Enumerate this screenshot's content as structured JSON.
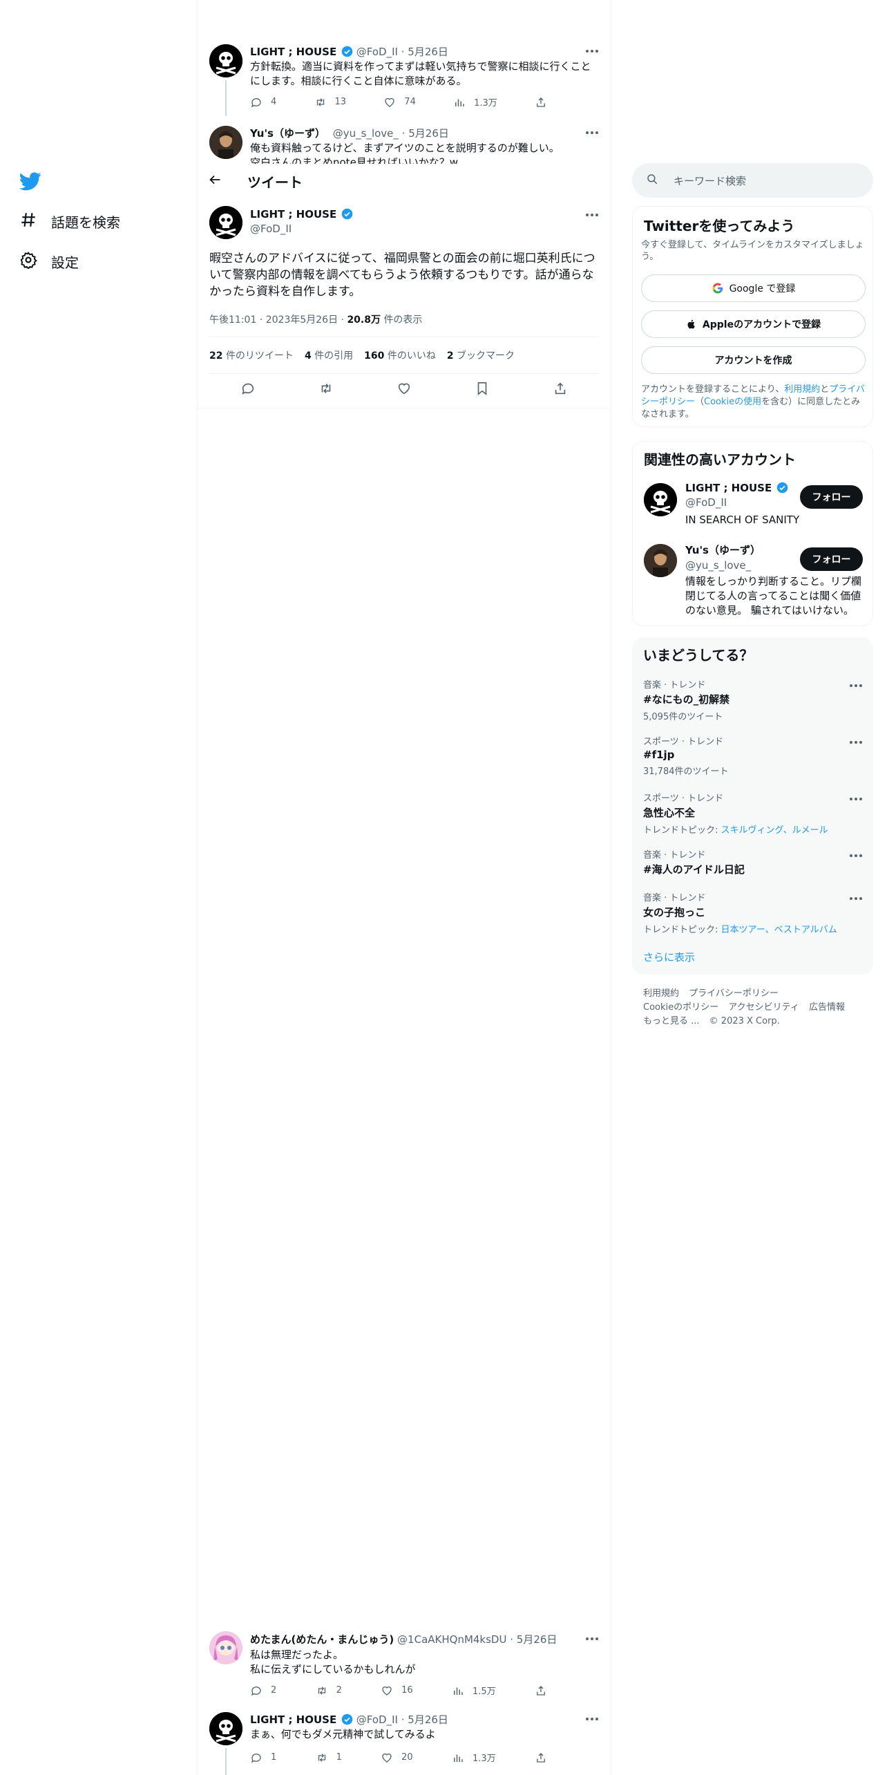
{
  "nav": {
    "items": [
      {
        "label": "話題を検索",
        "icon": "hashtag-icon"
      },
      {
        "label": "設定",
        "icon": "gear-icon"
      }
    ]
  },
  "header": {
    "title": "ツイート"
  },
  "thread_top": [
    {
      "name": "LIGHT ; HOUSE",
      "handle": "@FoD_II",
      "date": "· 5月26日",
      "text": "方針転換。適当に資料を作ってまずは軽い気持ちで警察に相談に行くことにします。相談に行くこと自体に意味がある。",
      "replies": "4",
      "retweets": "13",
      "likes": "74",
      "views": "1.3万"
    },
    {
      "name": "Yu's（ゆーず）",
      "handle": "@yu_s_love_",
      "date": "· 5月26日",
      "text": "俺も資料触ってるけど、まずアイツのことを説明するのが難しい。",
      "text2": "空白さんのまとめnote見せればいいかな？w"
    }
  ],
  "main_tweet": {
    "name": "LIGHT ; HOUSE",
    "handle": "@FoD_II",
    "text": "暇空さんのアドバイスに従って、福岡県警との面会の前に堀口英利氏について警察内部の情報を調べてもらうよう依頼するつもりです。話が通らなかったら資料を自作します。",
    "time": "午後11:01",
    "date": "2023年5月26日",
    "views": "20.8万",
    "views_label": "件の表示",
    "stats": [
      {
        "num": "22",
        "label": "件のリツイート"
      },
      {
        "num": "4",
        "label": "件の引用"
      },
      {
        "num": "160",
        "label": "件のいいね"
      },
      {
        "num": "2",
        "label": "ブックマーク"
      }
    ]
  },
  "replies": [
    {
      "name": "めたまん(めたん・まんじゅう)",
      "handle": "@1CaAKHQnM4ksDU",
      "date": "· 5月26日",
      "line1": "私は無理だったよ。",
      "line2": "私に伝えずにしているかもしれんが",
      "replies": "2",
      "retweets": "2",
      "likes": "16",
      "views": "1.5万"
    },
    {
      "name": "LIGHT ; HOUSE",
      "handle": "@FoD_II",
      "date": "· 5月26日",
      "line1": "まぁ、何でもダメ元精神で試してみるよ",
      "replies": "1",
      "retweets": "1",
      "likes": "20",
      "views": "1.3万"
    }
  ],
  "sidebar": {
    "search_placeholder": "キーワード検索",
    "signup": {
      "title": "Twitterを使ってみよう",
      "subtitle": "今すぐ登録して、タイムラインをカスタマイズしましょう。",
      "google": "Google で登録",
      "apple": "Appleのアカウントで登録",
      "create": "アカウントを作成",
      "legal_1": "アカウントを登録することにより、",
      "legal_terms": "利用規約",
      "legal_and": "と",
      "legal_privacy": "プライバシーポリシー",
      "legal_paren_open": "（",
      "legal_cookie": "Cookieの使用",
      "legal_2": "を含む）に同意したとみなされます。"
    },
    "related": {
      "title": "関連性の高いアカウント",
      "follow": "フォロー",
      "accounts": [
        {
          "name": "LIGHT ; HOUSE",
          "handle": "@FoD_II",
          "bio": "IN SEARCH OF SANITY"
        },
        {
          "name": "Yu's（ゆーず）",
          "handle": "@yu_s_love_",
          "bio": "情報をしっかり判断すること。リプ欄閉じてる人の言ってることは聞く価値のない意見。 騙されてはいけない。"
        }
      ]
    },
    "trends": {
      "title": "いまどうしてる？",
      "items": [
        {
          "category": "音楽 · トレンド",
          "name": "#なにもの_初解禁",
          "meta": "5,095件のツイート"
        },
        {
          "category": "スポーツ · トレンド",
          "name": "#f1jp",
          "meta": "31,784件のツイート"
        },
        {
          "category": "スポーツ · トレンド",
          "name": "急性心不全",
          "meta_prefix": "トレンドトピック: ",
          "meta_link": "スキルヴィング、ルメール"
        },
        {
          "category": "音楽 · トレンド",
          "name": "#海人のアイドル日記"
        },
        {
          "category": "音楽 · トレンド",
          "name": "女の子抱っこ",
          "meta_prefix": "トレンドトピック: ",
          "meta_link": "日本ツアー、ベストアルバム"
        }
      ],
      "show_more": "さらに表示"
    },
    "footer": {
      "line1": [
        "利用規約",
        "プライバシーポリシー"
      ],
      "line2": [
        "Cookieのポリシー",
        "アクセシビリティ",
        "広告情報"
      ],
      "more": "もっと見る ...",
      "copyright": "© 2023 X Corp."
    }
  },
  "colors": {
    "accent": "#1d9bf0",
    "text": "#0f1419",
    "muted": "#536471",
    "border": "#eff3f4"
  }
}
